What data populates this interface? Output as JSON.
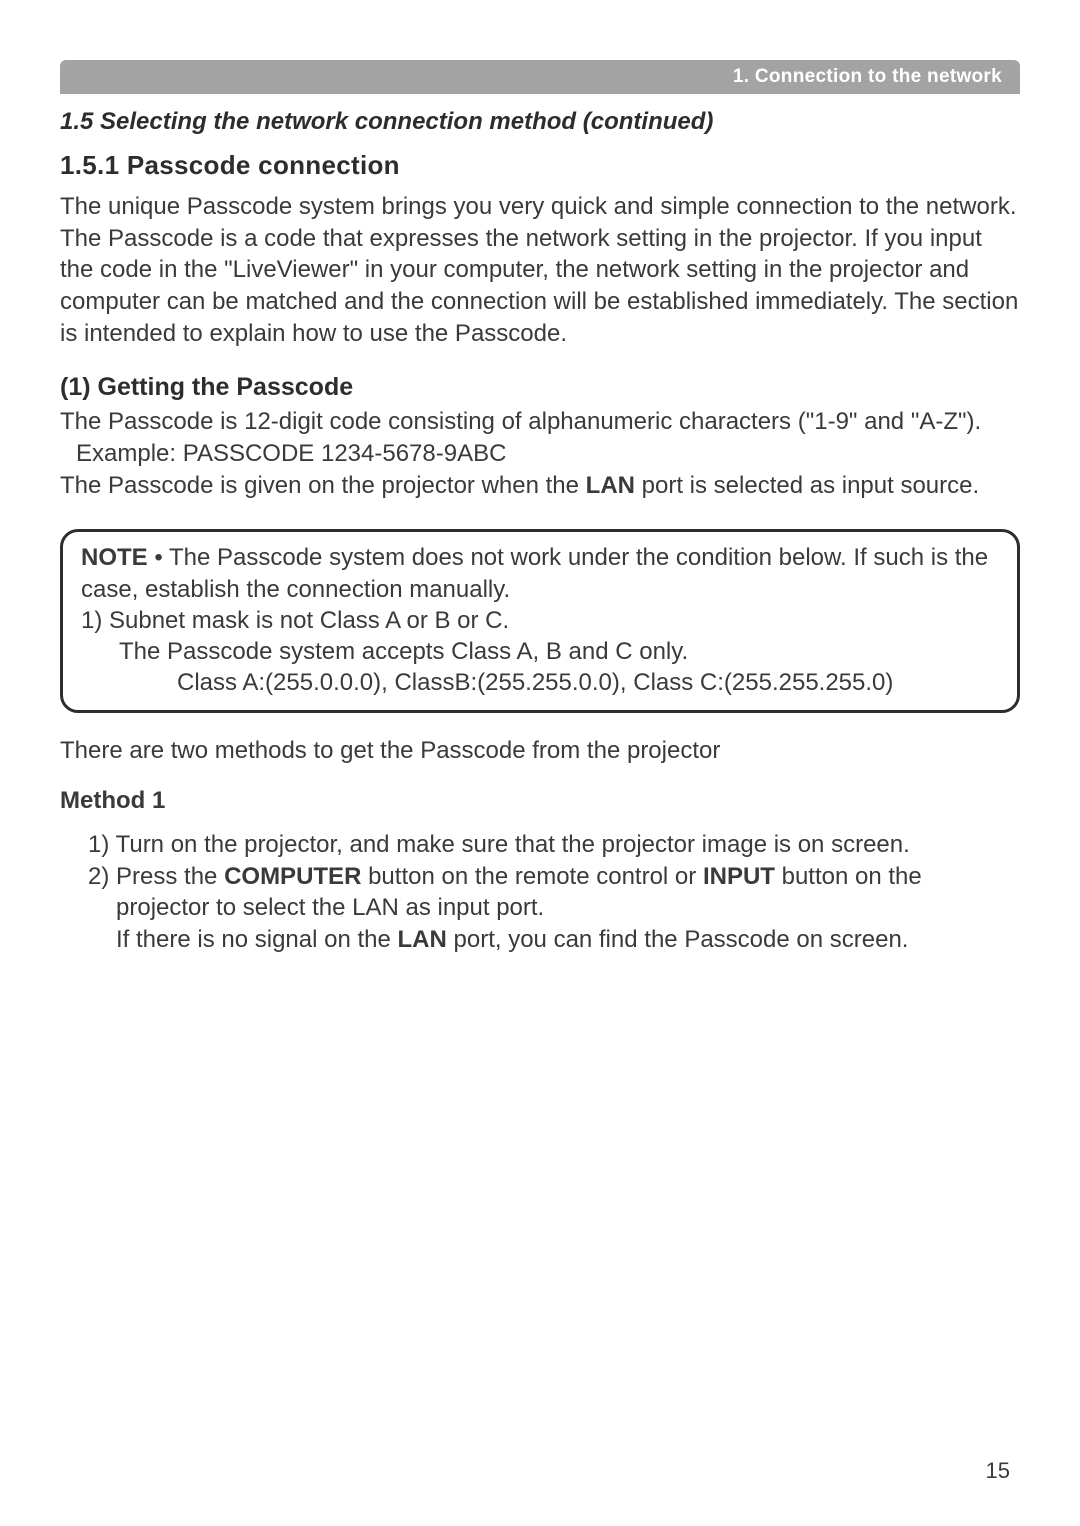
{
  "header": {
    "chapter_bar": "1. Connection to the network"
  },
  "titles": {
    "continued": "1.5 Selecting the network connection method (continued)",
    "section": "1.5.1 Passcode connection",
    "subsection": "(1) Getting the Passcode",
    "method": "Method 1"
  },
  "paragraphs": {
    "intro1": "The unique Passcode system brings you very quick and simple connection to the network.",
    "intro2": "The Passcode is a code that expresses the network setting in the projector. If you input the code in the \"LiveViewer\" in your computer, the network setting in the projector and computer can be matched and the connection will be established immediately. The section is intended to explain how to use the Passcode.",
    "getting1": "The Passcode is 12-digit code consisting of alphanumeric characters (\"1-9\" and \"A-Z\").",
    "example": "Example: PASSCODE 1234-5678-9ABC",
    "getting2a": "The Passcode is given on the projector when the ",
    "getting2_lan": "LAN",
    "getting2b": " port is selected as input source.",
    "two_methods": "There are two methods to get the Passcode from the projector"
  },
  "note": {
    "label": "NOTE",
    "line1": "  • The Passcode system does not work under the condition below. If such is the case, establish the connection manually.",
    "line2": "1) Subnet mask is not Class A or B or C.",
    "line3": "The Passcode system accepts Class A, B and C only.",
    "line4": "Class A:(255.0.0.0), ClassB:(255.255.0.0), Class C:(255.255.255.0)"
  },
  "steps": {
    "s1": "1) Turn on the projector, and make sure that the projector image is on screen.",
    "s2a": "2) Press the ",
    "s2_computer": "COMPUTER",
    "s2b": " button on the remote control or ",
    "s2_input": "INPUT",
    "s2c": " button on the projector to select the LAN as input port.",
    "s2d_a": "If there is no signal on the ",
    "s2d_lan": "LAN",
    "s2d_b": " port, you can ﬁnd the Passcode on screen."
  },
  "page_number": "15"
}
